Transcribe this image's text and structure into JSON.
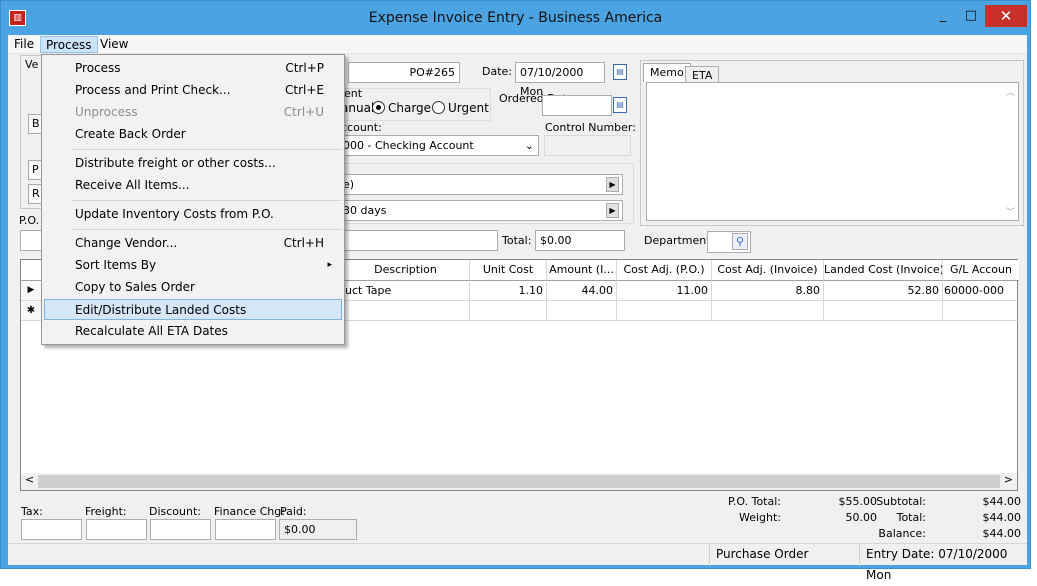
{
  "window": {
    "title": "Expense Invoice Entry - Business America",
    "minimize": "_",
    "maximize": "□",
    "close": "✕"
  },
  "menubar": {
    "file": "File",
    "process": "Process",
    "view": "View"
  },
  "process_menu": {
    "items": [
      {
        "label": "Process",
        "shortcut": "Ctrl+P"
      },
      {
        "label": "Process and Print Check...",
        "shortcut": "Ctrl+E"
      },
      {
        "label": "Unprocess",
        "shortcut": "Ctrl+U"
      },
      {
        "label": "Create Back Order",
        "shortcut": ""
      },
      {
        "label": "Distribute freight or other costs...",
        "shortcut": ""
      },
      {
        "label": "Receive All Items...",
        "shortcut": ""
      },
      {
        "label": "Update Inventory Costs from P.O.",
        "shortcut": ""
      },
      {
        "label": "Change Vendor...",
        "shortcut": "Ctrl+H"
      },
      {
        "label": "Sort Items By",
        "shortcut": "▸"
      },
      {
        "label": "Copy to Sales Order",
        "shortcut": ""
      },
      {
        "label": "Edit/Distribute Landed Costs",
        "shortcut": ""
      },
      {
        "label": "Recalculate All ETA Dates",
        "shortcut": ""
      }
    ]
  },
  "form": {
    "po_number": "PO#265",
    "date_label": "Date:",
    "date_value": "07/10/2000 Mon",
    "ordered_date_label": "Ordered Date:",
    "ordered_date_value": "",
    "payment_group_partial": "ent",
    "manual_partial": "anual",
    "charge_label": "Charge",
    "urgent_label": "Urgent",
    "account_label_partial": "ccount:",
    "account_value": "000 - Checking Account",
    "control_number_label": "Control Number:",
    "terms_partial_1": "e)",
    "terms_partial_2": "30 days",
    "total_label": "Total:",
    "total_value": "$0.00",
    "department_label": "Department:",
    "vendor_tab_partial": "Ve",
    "po_label": "P.O.",
    "left_btn_b": "B",
    "left_btn_p": "P",
    "left_btn_r": "R"
  },
  "memo_tabs": {
    "memo": "Memo",
    "eta": "ETA"
  },
  "grid": {
    "columns": [
      "Description",
      "Unit Cost",
      "Amount (I...",
      "Cost Adj. (P.O.)",
      "Cost Adj. (Invoice)",
      "Landed Cost (Invoice)",
      "G/L Accoun"
    ],
    "rows": [
      {
        "description": "uct Tape",
        "unit_cost": "1.10",
        "amount": "44.00",
        "cost_adj_po": "11.00",
        "cost_adj_invoice": "8.80",
        "landed_cost": "52.80",
        "gl_account": "60000-000"
      }
    ],
    "row_marker_current": "▶",
    "row_marker_new": "✱"
  },
  "footer": {
    "tax_label": "Tax:",
    "freight_label": "Freight:",
    "discount_label": "Discount:",
    "finance_label": "Finance Chg:",
    "paid_label": "Paid:",
    "paid_value": "$0.00",
    "po_total_label": "P.O. Total:",
    "po_total_value": "$55.00",
    "weight_label": "Weight:",
    "weight_value": "50.00",
    "subtotal_label": "Subtotal:",
    "subtotal_value": "$44.00",
    "total_label": "Total:",
    "total_value": "$44.00",
    "balance_label": "Balance:",
    "balance_value": "$44.00"
  },
  "statusbar": {
    "doc_type": "Purchase Order",
    "entry_date": "Entry Date: 07/10/2000 Mon"
  },
  "colors": {
    "titlebar": "#4ca3e2",
    "close": "#c7312b",
    "highlight": "#d5e6f7"
  }
}
